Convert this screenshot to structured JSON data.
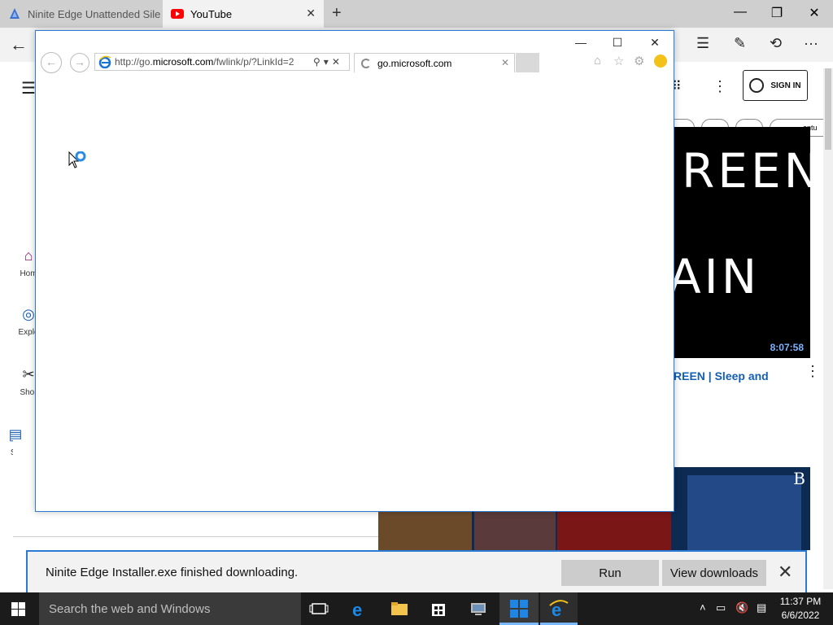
{
  "edge": {
    "tabs": [
      {
        "label": "Ninite Edge Unattended Sile"
      },
      {
        "label": "YouTube"
      }
    ],
    "signin_label": "SIGN IN"
  },
  "youtube": {
    "nav": [
      {
        "label": "Hom",
        "icon": "home-icon"
      },
      {
        "label": "Explo",
        "icon": "compass-icon"
      },
      {
        "label": "Shor",
        "icon": "shorts-icon"
      },
      {
        "label": "Su",
        "icon": "subscriptions-icon"
      }
    ],
    "chip_partial_text": "entu",
    "thumb_text_1": "REEN",
    "thumb_text_2": "AIN",
    "duration": "8:07:58",
    "video_title": "REEN | Sleep and",
    "thumb2_logo": "B"
  },
  "ie": {
    "url": "http://go.microsoft.com/fwlink/p/?LinkId=2",
    "tab_label": "go.microsoft.com"
  },
  "download_bar": {
    "message": "Ninite Edge Installer.exe finished downloading.",
    "run_label": "Run",
    "view_label": "View downloads"
  },
  "taskbar": {
    "search_placeholder": "Search the web and Windows",
    "time": "11:37 PM",
    "date": "6/6/2022"
  },
  "colors": {
    "accent": "#2b7bd4",
    "youtube_red": "#ff0000",
    "link_blue": "#1460b0"
  }
}
